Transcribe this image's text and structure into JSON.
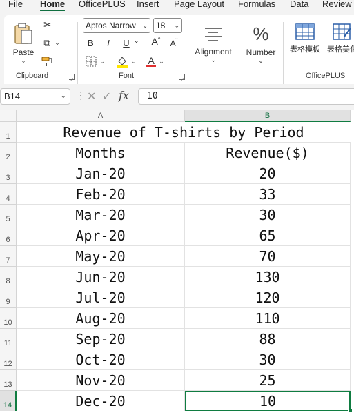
{
  "menu": {
    "tabs": [
      {
        "label": "File",
        "active": false
      },
      {
        "label": "Home",
        "active": true
      },
      {
        "label": "OfficePLUS",
        "active": false
      },
      {
        "label": "Insert",
        "active": false
      },
      {
        "label": "Page Layout",
        "active": false
      },
      {
        "label": "Formulas",
        "active": false
      },
      {
        "label": "Data",
        "active": false
      },
      {
        "label": "Review",
        "active": false
      }
    ]
  },
  "ribbon": {
    "clipboard": {
      "group_label": "Clipboard",
      "paste_label": "Paste"
    },
    "font": {
      "group_label": "Font",
      "font_name": "Aptos Narrow",
      "font_size": "18",
      "bold": "B",
      "italic": "I",
      "underline": "U"
    },
    "alignment": {
      "label": "Alignment"
    },
    "number": {
      "label": "Number",
      "icon_glyph": "%"
    },
    "officeplus": {
      "group_label": "OfficePLUS",
      "btn1": "表格模板",
      "btn2": "表格美化"
    },
    "colors": {
      "accent": "#107c41",
      "font_color": "#e03030",
      "highlight": "#ffe600"
    }
  },
  "formula_bar": {
    "name_box": "B14",
    "fx": "fx",
    "value": "10"
  },
  "sheet": {
    "columns": [
      "A",
      "B"
    ],
    "selected_column": "B",
    "selected_row": "14",
    "title": "Revenue of T-shirts by Period",
    "headers": [
      "Months",
      "Revenue($)"
    ],
    "rows": [
      {
        "num": "3",
        "month": "Jan-20",
        "revenue": "20"
      },
      {
        "num": "4",
        "month": "Feb-20",
        "revenue": "33"
      },
      {
        "num": "5",
        "month": "Mar-20",
        "revenue": "30"
      },
      {
        "num": "6",
        "month": "Apr-20",
        "revenue": "65"
      },
      {
        "num": "7",
        "month": "May-20",
        "revenue": "70"
      },
      {
        "num": "8",
        "month": "Jun-20",
        "revenue": "130"
      },
      {
        "num": "9",
        "month": "Jul-20",
        "revenue": "120"
      },
      {
        "num": "10",
        "month": "Aug-20",
        "revenue": "110"
      },
      {
        "num": "11",
        "month": "Sep-20",
        "revenue": "88"
      },
      {
        "num": "12",
        "month": "Oct-20",
        "revenue": "30"
      },
      {
        "num": "13",
        "month": "Nov-20",
        "revenue": "25"
      },
      {
        "num": "14",
        "month": "Dec-20",
        "revenue": "10"
      }
    ],
    "row_numbers": [
      "1",
      "2"
    ]
  }
}
